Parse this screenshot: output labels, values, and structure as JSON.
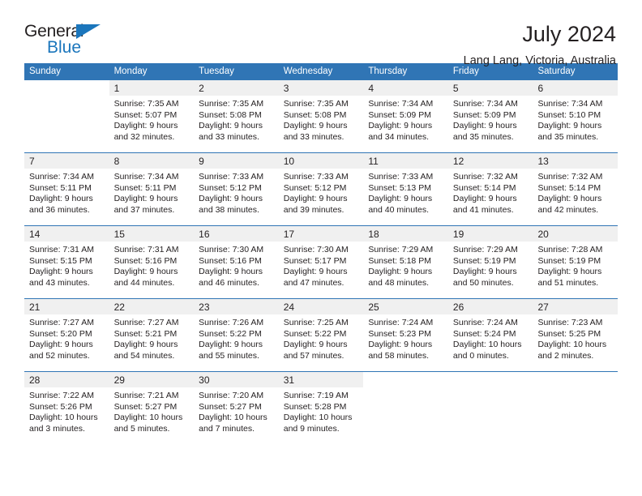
{
  "brand": {
    "name_top": "General",
    "name_bottom": "Blue",
    "color_dark": "#231f20",
    "color_blue": "#1b76bc"
  },
  "header": {
    "title": "July 2024",
    "subtitle": "Lang Lang, Victoria, Australia"
  },
  "theme": {
    "header_blue": "#3075b5",
    "daynum_band": "#f0f0f0",
    "text": "#231f20"
  },
  "weekday_headers": [
    "Sunday",
    "Monday",
    "Tuesday",
    "Wednesday",
    "Thursday",
    "Friday",
    "Saturday"
  ],
  "weeks": [
    [
      {
        "day": "",
        "blank": true,
        "lines": []
      },
      {
        "day": "1",
        "lines": [
          "Sunrise: 7:35 AM",
          "Sunset: 5:07 PM",
          "Daylight: 9 hours",
          "and 32 minutes."
        ]
      },
      {
        "day": "2",
        "lines": [
          "Sunrise: 7:35 AM",
          "Sunset: 5:08 PM",
          "Daylight: 9 hours",
          "and 33 minutes."
        ]
      },
      {
        "day": "3",
        "lines": [
          "Sunrise: 7:35 AM",
          "Sunset: 5:08 PM",
          "Daylight: 9 hours",
          "and 33 minutes."
        ]
      },
      {
        "day": "4",
        "lines": [
          "Sunrise: 7:34 AM",
          "Sunset: 5:09 PM",
          "Daylight: 9 hours",
          "and 34 minutes."
        ]
      },
      {
        "day": "5",
        "lines": [
          "Sunrise: 7:34 AM",
          "Sunset: 5:09 PM",
          "Daylight: 9 hours",
          "and 35 minutes."
        ]
      },
      {
        "day": "6",
        "lines": [
          "Sunrise: 7:34 AM",
          "Sunset: 5:10 PM",
          "Daylight: 9 hours",
          "and 35 minutes."
        ]
      }
    ],
    [
      {
        "day": "7",
        "lines": [
          "Sunrise: 7:34 AM",
          "Sunset: 5:11 PM",
          "Daylight: 9 hours",
          "and 36 minutes."
        ]
      },
      {
        "day": "8",
        "lines": [
          "Sunrise: 7:34 AM",
          "Sunset: 5:11 PM",
          "Daylight: 9 hours",
          "and 37 minutes."
        ]
      },
      {
        "day": "9",
        "lines": [
          "Sunrise: 7:33 AM",
          "Sunset: 5:12 PM",
          "Daylight: 9 hours",
          "and 38 minutes."
        ]
      },
      {
        "day": "10",
        "lines": [
          "Sunrise: 7:33 AM",
          "Sunset: 5:12 PM",
          "Daylight: 9 hours",
          "and 39 minutes."
        ]
      },
      {
        "day": "11",
        "lines": [
          "Sunrise: 7:33 AM",
          "Sunset: 5:13 PM",
          "Daylight: 9 hours",
          "and 40 minutes."
        ]
      },
      {
        "day": "12",
        "lines": [
          "Sunrise: 7:32 AM",
          "Sunset: 5:14 PM",
          "Daylight: 9 hours",
          "and 41 minutes."
        ]
      },
      {
        "day": "13",
        "lines": [
          "Sunrise: 7:32 AM",
          "Sunset: 5:14 PM",
          "Daylight: 9 hours",
          "and 42 minutes."
        ]
      }
    ],
    [
      {
        "day": "14",
        "lines": [
          "Sunrise: 7:31 AM",
          "Sunset: 5:15 PM",
          "Daylight: 9 hours",
          "and 43 minutes."
        ]
      },
      {
        "day": "15",
        "lines": [
          "Sunrise: 7:31 AM",
          "Sunset: 5:16 PM",
          "Daylight: 9 hours",
          "and 44 minutes."
        ]
      },
      {
        "day": "16",
        "lines": [
          "Sunrise: 7:30 AM",
          "Sunset: 5:16 PM",
          "Daylight: 9 hours",
          "and 46 minutes."
        ]
      },
      {
        "day": "17",
        "lines": [
          "Sunrise: 7:30 AM",
          "Sunset: 5:17 PM",
          "Daylight: 9 hours",
          "and 47 minutes."
        ]
      },
      {
        "day": "18",
        "lines": [
          "Sunrise: 7:29 AM",
          "Sunset: 5:18 PM",
          "Daylight: 9 hours",
          "and 48 minutes."
        ]
      },
      {
        "day": "19",
        "lines": [
          "Sunrise: 7:29 AM",
          "Sunset: 5:19 PM",
          "Daylight: 9 hours",
          "and 50 minutes."
        ]
      },
      {
        "day": "20",
        "lines": [
          "Sunrise: 7:28 AM",
          "Sunset: 5:19 PM",
          "Daylight: 9 hours",
          "and 51 minutes."
        ]
      }
    ],
    [
      {
        "day": "21",
        "lines": [
          "Sunrise: 7:27 AM",
          "Sunset: 5:20 PM",
          "Daylight: 9 hours",
          "and 52 minutes."
        ]
      },
      {
        "day": "22",
        "lines": [
          "Sunrise: 7:27 AM",
          "Sunset: 5:21 PM",
          "Daylight: 9 hours",
          "and 54 minutes."
        ]
      },
      {
        "day": "23",
        "lines": [
          "Sunrise: 7:26 AM",
          "Sunset: 5:22 PM",
          "Daylight: 9 hours",
          "and 55 minutes."
        ]
      },
      {
        "day": "24",
        "lines": [
          "Sunrise: 7:25 AM",
          "Sunset: 5:22 PM",
          "Daylight: 9 hours",
          "and 57 minutes."
        ]
      },
      {
        "day": "25",
        "lines": [
          "Sunrise: 7:24 AM",
          "Sunset: 5:23 PM",
          "Daylight: 9 hours",
          "and 58 minutes."
        ]
      },
      {
        "day": "26",
        "lines": [
          "Sunrise: 7:24 AM",
          "Sunset: 5:24 PM",
          "Daylight: 10 hours",
          "and 0 minutes."
        ]
      },
      {
        "day": "27",
        "lines": [
          "Sunrise: 7:23 AM",
          "Sunset: 5:25 PM",
          "Daylight: 10 hours",
          "and 2 minutes."
        ]
      }
    ],
    [
      {
        "day": "28",
        "lines": [
          "Sunrise: 7:22 AM",
          "Sunset: 5:26 PM",
          "Daylight: 10 hours",
          "and 3 minutes."
        ]
      },
      {
        "day": "29",
        "lines": [
          "Sunrise: 7:21 AM",
          "Sunset: 5:27 PM",
          "Daylight: 10 hours",
          "and 5 minutes."
        ]
      },
      {
        "day": "30",
        "lines": [
          "Sunrise: 7:20 AM",
          "Sunset: 5:27 PM",
          "Daylight: 10 hours",
          "and 7 minutes."
        ]
      },
      {
        "day": "31",
        "lines": [
          "Sunrise: 7:19 AM",
          "Sunset: 5:28 PM",
          "Daylight: 10 hours",
          "and 9 minutes."
        ]
      },
      {
        "day": "",
        "blank": true,
        "lines": []
      },
      {
        "day": "",
        "blank": true,
        "lines": []
      },
      {
        "day": "",
        "blank": true,
        "lines": []
      }
    ]
  ]
}
